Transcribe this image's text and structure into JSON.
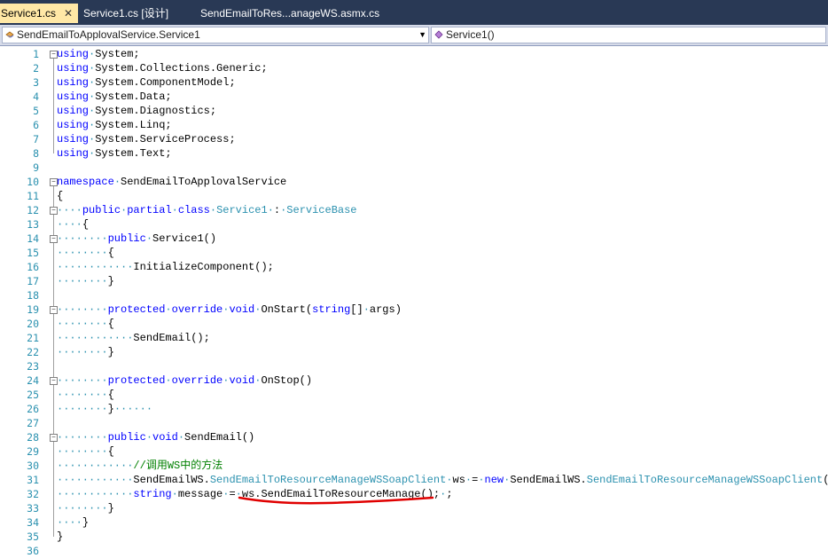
{
  "tabs": [
    {
      "label": "Service1.cs",
      "active": true
    },
    {
      "label": "Service1.cs [设计]",
      "active": false
    },
    {
      "label": "SendEmailToRes...anageWS.asmx.cs",
      "active": false
    }
  ],
  "nav": {
    "class_combo": "SendEmailToApplovalService.Service1",
    "member_combo": "Service1()"
  },
  "lines": [
    {
      "n": "1",
      "tokens": [
        [
          "kw",
          "using"
        ],
        [
          "ws",
          "·"
        ],
        [
          "t",
          "System;"
        ]
      ]
    },
    {
      "n": "2",
      "tokens": [
        [
          "kw",
          "using"
        ],
        [
          "ws",
          "·"
        ],
        [
          "t",
          "System.Collections.Generic;"
        ]
      ]
    },
    {
      "n": "3",
      "tokens": [
        [
          "kw",
          "using"
        ],
        [
          "ws",
          "·"
        ],
        [
          "t",
          "System.ComponentModel;"
        ]
      ]
    },
    {
      "n": "4",
      "tokens": [
        [
          "kw",
          "using"
        ],
        [
          "ws",
          "·"
        ],
        [
          "t",
          "System.Data;"
        ]
      ]
    },
    {
      "n": "5",
      "tokens": [
        [
          "kw",
          "using"
        ],
        [
          "ws",
          "·"
        ],
        [
          "t",
          "System.Diagnostics;"
        ]
      ]
    },
    {
      "n": "6",
      "tokens": [
        [
          "kw",
          "using"
        ],
        [
          "ws",
          "·"
        ],
        [
          "t",
          "System.Linq;"
        ]
      ]
    },
    {
      "n": "7",
      "tokens": [
        [
          "kw",
          "using"
        ],
        [
          "ws",
          "·"
        ],
        [
          "t",
          "System.ServiceProcess;"
        ]
      ]
    },
    {
      "n": "8",
      "tokens": [
        [
          "kw",
          "using"
        ],
        [
          "ws",
          "·"
        ],
        [
          "t",
          "System.Text;"
        ]
      ]
    },
    {
      "n": "9",
      "tokens": []
    },
    {
      "n": "10",
      "tokens": [
        [
          "kw",
          "namespace"
        ],
        [
          "ws",
          "·"
        ],
        [
          "t",
          "SendEmailToApplovalService"
        ]
      ]
    },
    {
      "n": "11",
      "tokens": [
        [
          "t",
          "{"
        ]
      ]
    },
    {
      "n": "12",
      "tokens": [
        [
          "ws",
          "····"
        ],
        [
          "kw",
          "public"
        ],
        [
          "ws",
          "·"
        ],
        [
          "kw",
          "partial"
        ],
        [
          "ws",
          "·"
        ],
        [
          "kw",
          "class"
        ],
        [
          "ws",
          "·"
        ],
        [
          "ty",
          "Service1"
        ],
        [
          "ws",
          "·"
        ],
        [
          "t",
          ":"
        ],
        [
          "ws",
          "·"
        ],
        [
          "ty",
          "ServiceBase"
        ]
      ]
    },
    {
      "n": "13",
      "tokens": [
        [
          "ws",
          "····"
        ],
        [
          "t",
          "{"
        ]
      ]
    },
    {
      "n": "14",
      "tokens": [
        [
          "ws",
          "········"
        ],
        [
          "kw",
          "public"
        ],
        [
          "ws",
          "·"
        ],
        [
          "t",
          "Service1()"
        ]
      ]
    },
    {
      "n": "15",
      "tokens": [
        [
          "ws",
          "········"
        ],
        [
          "t",
          "{"
        ]
      ]
    },
    {
      "n": "16",
      "tokens": [
        [
          "ws",
          "············"
        ],
        [
          "t",
          "InitializeComponent();"
        ]
      ]
    },
    {
      "n": "17",
      "tokens": [
        [
          "ws",
          "········"
        ],
        [
          "t",
          "}"
        ]
      ]
    },
    {
      "n": "18",
      "tokens": []
    },
    {
      "n": "19",
      "tokens": [
        [
          "ws",
          "········"
        ],
        [
          "kw",
          "protected"
        ],
        [
          "ws",
          "·"
        ],
        [
          "kw",
          "override"
        ],
        [
          "ws",
          "·"
        ],
        [
          "kw",
          "void"
        ],
        [
          "ws",
          "·"
        ],
        [
          "t",
          "OnStart("
        ],
        [
          "kw",
          "string"
        ],
        [
          "t",
          "[]"
        ],
        [
          "ws",
          "·"
        ],
        [
          "t",
          "args)"
        ]
      ]
    },
    {
      "n": "20",
      "tokens": [
        [
          "ws",
          "········"
        ],
        [
          "t",
          "{"
        ]
      ]
    },
    {
      "n": "21",
      "tokens": [
        [
          "ws",
          "············"
        ],
        [
          "t",
          "SendEmail();"
        ]
      ]
    },
    {
      "n": "22",
      "tokens": [
        [
          "ws",
          "········"
        ],
        [
          "t",
          "}"
        ]
      ]
    },
    {
      "n": "23",
      "tokens": []
    },
    {
      "n": "24",
      "tokens": [
        [
          "ws",
          "········"
        ],
        [
          "kw",
          "protected"
        ],
        [
          "ws",
          "·"
        ],
        [
          "kw",
          "override"
        ],
        [
          "ws",
          "·"
        ],
        [
          "kw",
          "void"
        ],
        [
          "ws",
          "·"
        ],
        [
          "t",
          "OnStop()"
        ]
      ]
    },
    {
      "n": "25",
      "tokens": [
        [
          "ws",
          "········"
        ],
        [
          "t",
          "{"
        ]
      ]
    },
    {
      "n": "26",
      "tokens": [
        [
          "ws",
          "········"
        ],
        [
          "t",
          "}"
        ],
        [
          "ws",
          "······"
        ]
      ]
    },
    {
      "n": "27",
      "tokens": []
    },
    {
      "n": "28",
      "tokens": [
        [
          "ws",
          "········"
        ],
        [
          "kw",
          "public"
        ],
        [
          "ws",
          "·"
        ],
        [
          "kw",
          "void"
        ],
        [
          "ws",
          "·"
        ],
        [
          "t",
          "SendEmail()"
        ]
      ]
    },
    {
      "n": "29",
      "tokens": [
        [
          "ws",
          "········"
        ],
        [
          "t",
          "{"
        ]
      ]
    },
    {
      "n": "30",
      "tokens": [
        [
          "ws",
          "············"
        ],
        [
          "cm",
          "//调用WS中的方法"
        ]
      ]
    },
    {
      "n": "31",
      "tokens": [
        [
          "ws",
          "············"
        ],
        [
          "t",
          "SendEmailWS."
        ],
        [
          "ty",
          "SendEmailToResourceManageWSSoapClient"
        ],
        [
          "ws",
          "·"
        ],
        [
          "t",
          "ws"
        ],
        [
          "ws",
          "·"
        ],
        [
          "t",
          "="
        ],
        [
          "ws",
          "·"
        ],
        [
          "kw",
          "new"
        ],
        [
          "ws",
          "·"
        ],
        [
          "t",
          "SendEmailWS."
        ],
        [
          "ty",
          "SendEmailToResourceManageWSSoapClient"
        ],
        [
          "t",
          "();"
        ]
      ]
    },
    {
      "n": "32",
      "tokens": [
        [
          "ws",
          "············"
        ],
        [
          "kw",
          "string"
        ],
        [
          "ws",
          "·"
        ],
        [
          "t",
          "message"
        ],
        [
          "ws",
          "·"
        ],
        [
          "t",
          "="
        ],
        [
          "ws",
          "·"
        ],
        [
          "t",
          "ws.SendEmailToResourceManage();"
        ],
        [
          "ws",
          "·"
        ],
        [
          "t",
          ";"
        ]
      ]
    },
    {
      "n": "33",
      "tokens": [
        [
          "ws",
          "········"
        ],
        [
          "t",
          "}"
        ]
      ]
    },
    {
      "n": "34",
      "tokens": [
        [
          "ws",
          "····"
        ],
        [
          "t",
          "}"
        ]
      ]
    },
    {
      "n": "35",
      "tokens": [
        [
          "t",
          "}"
        ]
      ]
    },
    {
      "n": "36",
      "tokens": []
    }
  ]
}
